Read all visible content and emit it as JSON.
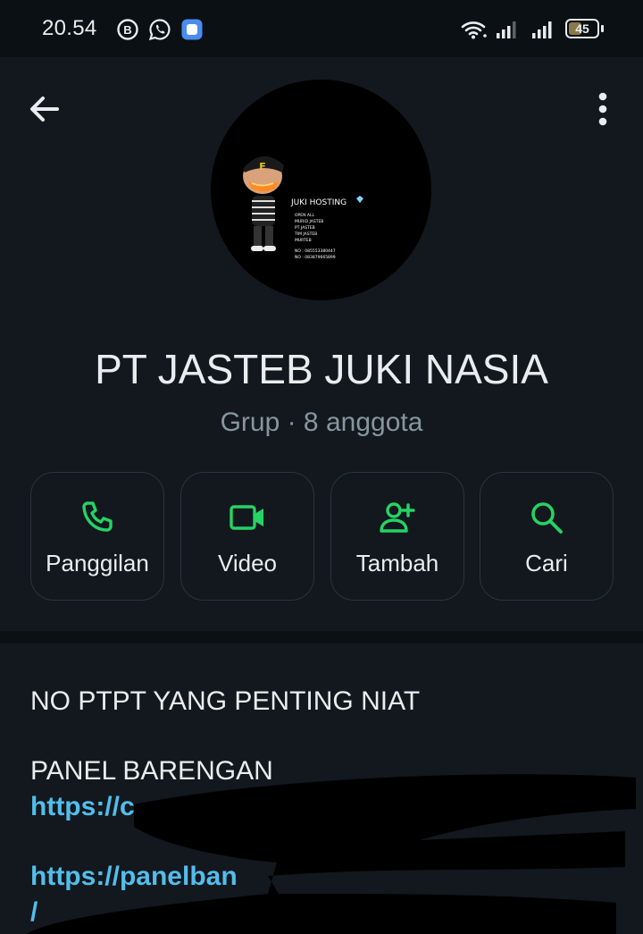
{
  "status_bar": {
    "time": "20.54",
    "icons": [
      "b-icon",
      "whatsapp-icon",
      "app-notification-icon",
      "wifi-icon",
      "signal-1-icon",
      "signal-2-icon"
    ],
    "battery": "45",
    "battery_level_percent": 45
  },
  "header": {
    "avatar_text": {
      "brand": "JUKI HOSTING",
      "lines": [
        "OPEN ALL",
        "MURID JASTEB",
        "PT JASTEB",
        "TIM JASTEB",
        "MURTEB"
      ],
      "contacts": [
        "NO : 085553380447",
        "NO : 083879665899"
      ]
    },
    "group_name": "PT JASTEB JUKI NASIA",
    "subtitle": "Grup · 8 anggota",
    "actions": [
      {
        "label": "Panggilan",
        "icon": "phone-icon"
      },
      {
        "label": "Video",
        "icon": "video-icon"
      },
      {
        "label": "Tambah",
        "icon": "add-person-icon"
      },
      {
        "label": "Cari",
        "icon": "search-icon"
      }
    ]
  },
  "description": {
    "line1": "NO PTPT YANG PENTING NIAT",
    "line2": "PANEL BARENGAN",
    "link1": "https://c",
    "link2": "https://panelban",
    "link3": "/"
  },
  "colors": {
    "accent": "#25d366",
    "link": "#53bdeb",
    "background": "#0b1014",
    "card": "#12181d",
    "muted_text": "#8696a0"
  }
}
